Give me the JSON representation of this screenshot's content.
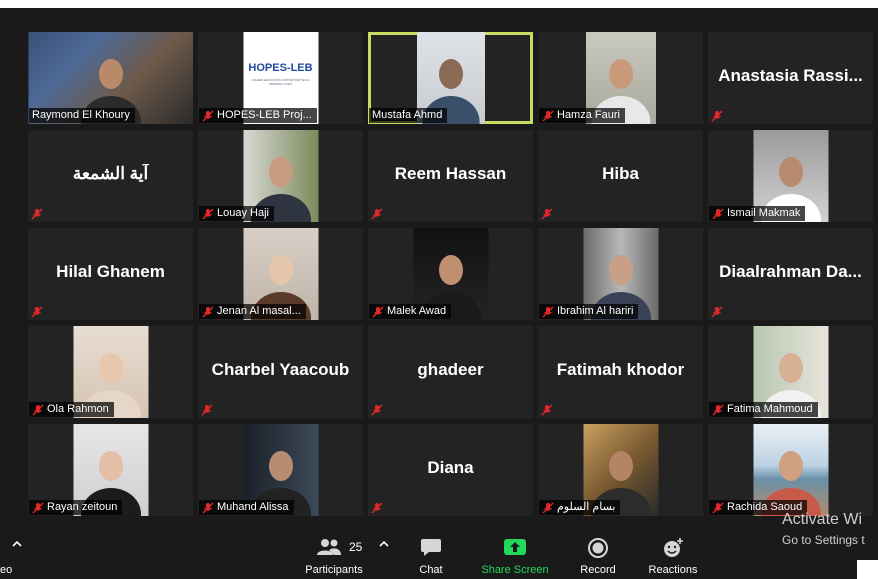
{
  "meeting": {
    "tiles": [
      {
        "name": "Raymond El Khoury",
        "kind": "photo",
        "muted": false,
        "active": false,
        "scene": "presenter-office"
      },
      {
        "name": "HOPES-LEB Proj...",
        "kind": "logo",
        "muted": true,
        "active": false,
        "logo_text": "HOPES-LEB",
        "logo_sub": "HIGHER EDUCATION OPPORTUNITIES & PERSPECTIVES"
      },
      {
        "name": "Mustafa Ahmd",
        "kind": "photo",
        "muted": false,
        "active": true,
        "scene": "man-jacket"
      },
      {
        "name": "Hamza Fauri",
        "kind": "photo",
        "muted": true,
        "active": false,
        "scene": "man-shirt"
      },
      {
        "name": "Anastasia Rassi...",
        "kind": "name",
        "muted": true,
        "active": false
      },
      {
        "name": "آية الشمعة",
        "kind": "name",
        "muted": true,
        "active": false
      },
      {
        "name": "Louay Haji",
        "kind": "photo",
        "muted": true,
        "active": false,
        "scene": "man-suit-tree"
      },
      {
        "name": "Reem Hassan",
        "kind": "name",
        "muted": true,
        "active": false
      },
      {
        "name": "Hiba",
        "kind": "name",
        "muted": true,
        "active": false
      },
      {
        "name": "Ismail Makmak",
        "kind": "photo",
        "muted": true,
        "active": false,
        "scene": "man-bowtie"
      },
      {
        "name": "Hilal Ghanem",
        "kind": "name",
        "muted": true,
        "active": false
      },
      {
        "name": "Jenan Al masal...",
        "kind": "photo",
        "muted": true,
        "active": false,
        "scene": "woman-hair"
      },
      {
        "name": "Malek Awad",
        "kind": "photo",
        "muted": true,
        "active": false,
        "scene": "man-dark"
      },
      {
        "name": "Ibrahim Al hariri",
        "kind": "photo",
        "muted": true,
        "active": false,
        "scene": "man-suit-street"
      },
      {
        "name": "Diaalrahman Da...",
        "kind": "name",
        "muted": true,
        "active": false
      },
      {
        "name": "Ola Rahmon",
        "kind": "photo",
        "muted": true,
        "active": false,
        "scene": "woman-hijab-light"
      },
      {
        "name": "Charbel Yaacoub",
        "kind": "name",
        "muted": true,
        "active": false
      },
      {
        "name": "ghadeer",
        "kind": "name",
        "muted": true,
        "active": false
      },
      {
        "name": "Fatimah khodor",
        "kind": "name",
        "muted": true,
        "active": false
      },
      {
        "name": "Fatima Mahmoud",
        "kind": "photo",
        "muted": true,
        "active": false,
        "scene": "woman-hijab-white"
      },
      {
        "name": "Rayan zeitoun",
        "kind": "photo",
        "muted": true,
        "active": false,
        "scene": "woman-hijab-black"
      },
      {
        "name": "Muhand Alissa",
        "kind": "photo",
        "muted": true,
        "active": false,
        "scene": "man-headset"
      },
      {
        "name": "Diana",
        "kind": "name",
        "muted": true,
        "active": false
      },
      {
        "name": "بسام السلوم",
        "kind": "photo",
        "muted": true,
        "active": false,
        "scene": "man-camera"
      },
      {
        "name": "Rachida Saoud",
        "kind": "photo",
        "muted": true,
        "active": false,
        "scene": "woman-sea"
      }
    ]
  },
  "toolbar": {
    "left_fragment": "eo",
    "participants_count": "25",
    "participants_label": "Participants",
    "chat_label": "Chat",
    "share_label": "Share Screen",
    "record_label": "Record",
    "reactions_label": "Reactions"
  },
  "watermark": {
    "title": "Activate Wi",
    "subtitle": "Go to Settings t"
  },
  "colors": {
    "background": "#1a1a1a",
    "tile": "#232323",
    "active_border": "#c8dc62",
    "muted_red": "#e02828",
    "share_green": "#23d959"
  }
}
